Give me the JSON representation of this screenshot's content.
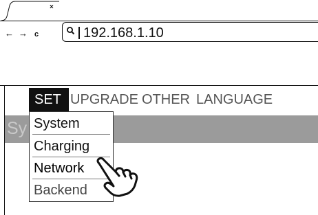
{
  "browser": {
    "tab_close": "×",
    "nav_back": "←",
    "nav_forward": "→",
    "nav_reload": "c",
    "address": "192.168.1.10"
  },
  "menu": {
    "items": [
      "SET",
      "UPGRADE",
      "OTHER",
      "LANGUAGE"
    ],
    "active": "SET"
  },
  "banner": {
    "text": "Sy"
  },
  "dropdown": {
    "items": [
      "System",
      "Charging",
      "Network",
      "Backend"
    ],
    "highlighted": "Network"
  },
  "colors": {
    "banner": "#9b9b9b",
    "menu_active_bg": "#111111",
    "text": "#111111"
  },
  "icons": [
    "close-icon",
    "back-arrow-icon",
    "forward-arrow-icon",
    "reload-icon",
    "search-icon",
    "pointing-hand-icon"
  ]
}
